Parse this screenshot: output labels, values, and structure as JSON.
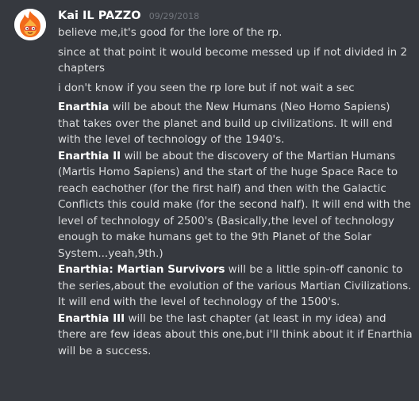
{
  "message": {
    "author": "Kai IL PAZZO",
    "timestamp": "09/29/2018",
    "avatar_icon": "fire-face-avatar",
    "accent_color": "#f26a1b",
    "lines": [
      "believe me,it's good for the lore of the rp.",
      "since at that point it would become messed up if not divided in 2 chapters",
      "i don't know if you seen the rp lore but if not wait a sec"
    ],
    "paragraphs": [
      {
        "title": "Enarthia",
        "text": " will be about the New Humans (Neo Homo Sapiens) that takes over the planet and build up civilizations. It will end with the level of technology of the 1940's."
      },
      {
        "title": "Enarthia II",
        "text": " will be about the discovery of the Martian Humans (Martis Homo Sapiens) and the start of the huge Space Race to reach eachother (for the first half) and then with the Galactic Conflicts this could make (for the second half). It will end with the level of technology of 2500's (Basically,the level of technology enough to make humans get to the 9th Planet of the Solar System...yeah,9th.)"
      },
      {
        "title": "Enarthia: Martian Survivors",
        "text": " will be a little spin-off canonic to the series,about the evolution of the various Martian Civilizations. It will end with the level of technology of the 1500's."
      },
      {
        "title": "Enarthia III",
        "text": " will be the last chapter (at least in my idea) and there are few ideas about this one,but i'll think about it if Enarthia will be a success."
      }
    ]
  }
}
